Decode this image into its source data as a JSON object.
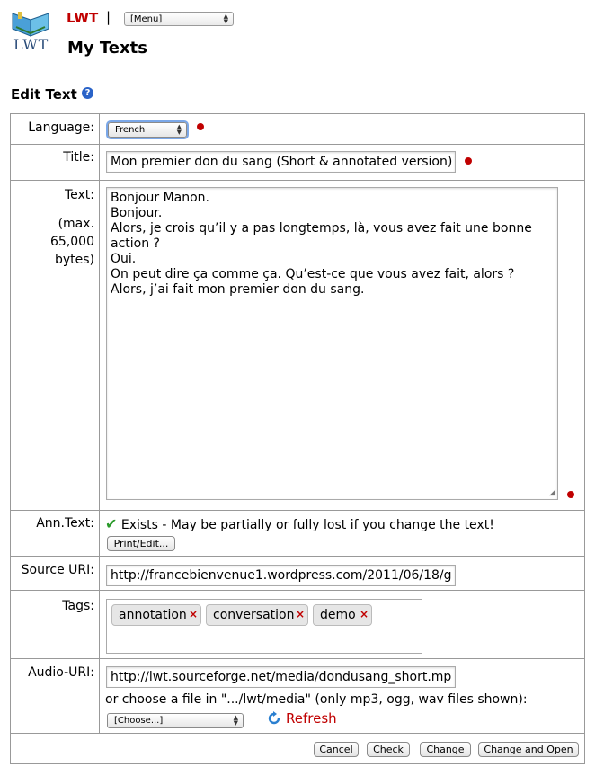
{
  "header": {
    "logo_text": "LWT",
    "app_name": "LWT",
    "separator": "|",
    "menu_select": "[Menu]",
    "page_title": "My Texts"
  },
  "section": {
    "title": "Edit Text",
    "help_icon": "help-icon",
    "help_glyph": "?"
  },
  "form": {
    "language": {
      "label": "Language:",
      "value": "French"
    },
    "title": {
      "label": "Title:",
      "value": "Mon premier don du sang (Short & annotated version)"
    },
    "text": {
      "label": "Text:",
      "note": "(max. 65,000 bytes)",
      "lines": [
        "Bonjour Manon.",
        "Bonjour.",
        "Alors, je crois qu’il y a pas longtemps, là, vous avez fait une bonne",
        "action ?",
        "Oui.",
        "On peut dire ça comme ça. Qu’est-ce que vous avez fait, alors ?",
        "Alors, j’ai fait mon premier don du sang."
      ]
    },
    "ann_text": {
      "label": "Ann.Text:",
      "status": "Exists - May be partially or fully lost if you change the text!",
      "button": "Print/Edit..."
    },
    "source_uri": {
      "label": "Source URI:",
      "value": "http://francebienvenue1.wordpress.com/2011/06/18/g"
    },
    "tags": {
      "label": "Tags:",
      "items": [
        "annotation",
        "conversation",
        "demo"
      ],
      "remove_glyph": "×"
    },
    "audio_uri": {
      "label": "Audio-URI:",
      "value": "http://lwt.sourceforge.net/media/dondusang_short.mp",
      "choose_text": "or choose a file in \".../lwt/media\" (only mp3, ogg, wav files shown):",
      "choose_select": "[Choose...]",
      "refresh_label": "Refresh"
    },
    "buttons": {
      "cancel": "Cancel",
      "check": "Check",
      "change": "Change",
      "change_open": "Change and Open"
    }
  },
  "colors": {
    "accent_red": "#c00000",
    "help_blue": "#2a63c8",
    "check_green": "#2a9a2a"
  }
}
